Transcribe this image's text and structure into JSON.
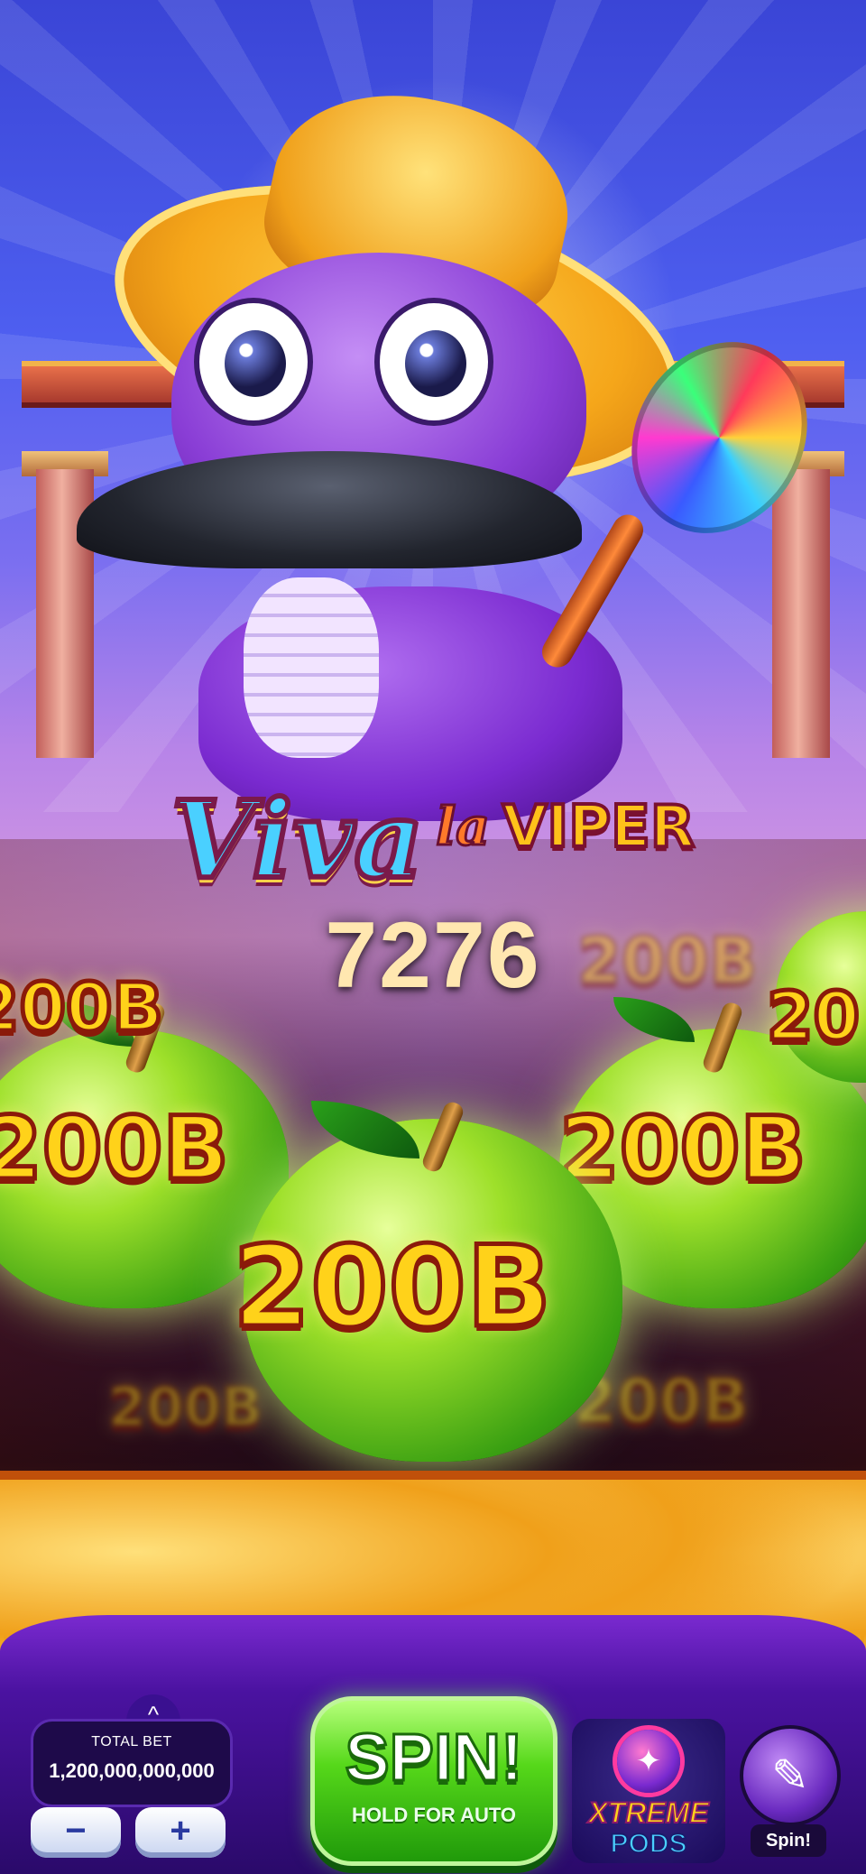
{
  "game": {
    "title_part1": "Viva",
    "title_part2": "la",
    "title_part3": "VIPER",
    "counter": "7276"
  },
  "reels": {
    "prizes": [
      "200B",
      "200B",
      "200B",
      "200B",
      "200B",
      "200B",
      "200B",
      "20"
    ]
  },
  "controls": {
    "total_bet_label": "TOTAL BET",
    "total_bet_value": "1,200,000,000,000",
    "minus_label": "−",
    "plus_label": "+",
    "expand_icon": "^",
    "spin_label": "SPIN!",
    "spin_sublabel": "HOLD FOR AUTO",
    "xtreme_line1": "XTREME",
    "xtreme_line2": "PODS",
    "daily_spin_label": "Spin!"
  },
  "colors": {
    "spin_green": "#56d81a",
    "prize_gold": "#ffd21a",
    "bar_purple": "#4a12a0"
  }
}
